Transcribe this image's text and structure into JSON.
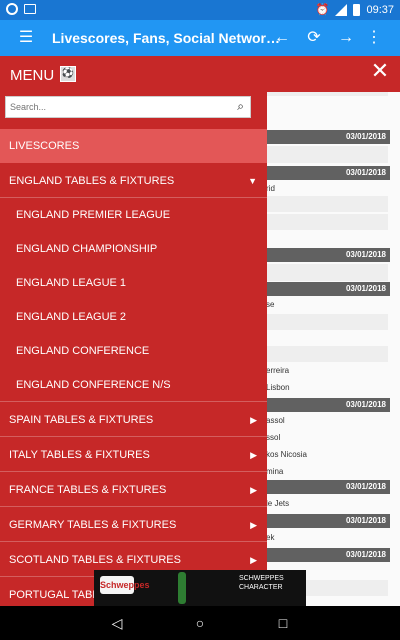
{
  "status_bar": {
    "time": "09:37"
  },
  "toolbar": {
    "title": "Livescores, Fans, Social Networ…",
    "menu_icon": "hamburger-icon",
    "back_icon": "arrow-left-icon",
    "refresh_icon": "refresh-icon",
    "forward_icon": "arrow-right-icon",
    "more_icon": "more-vert-icon"
  },
  "drawer": {
    "title": "MENU",
    "search_placeholder": "Search...",
    "items": [
      {
        "label": "LIVESCORES"
      },
      {
        "label": "ENGLAND TABLES & FIXTURES"
      },
      {
        "label": "ENGLAND PREMIER LEAGUE"
      },
      {
        "label": "ENGLAND CHAMPIONSHIP"
      },
      {
        "label": "ENGLAND LEAGUE 1"
      },
      {
        "label": "ENGLAND LEAGUE 2"
      },
      {
        "label": "ENGLAND CONFERENCE"
      },
      {
        "label": "ENGLAND CONFERENCE N/S"
      },
      {
        "label": "SPAIN TABLES & FIXTURES"
      },
      {
        "label": "ITALY TABLES & FIXTURES"
      },
      {
        "label": "FRANCE TABLES & FIXTURES"
      },
      {
        "label": "GERMARY TABLES & FIXTURES"
      },
      {
        "label": "SCOTLAND TABLES & FIXTURES"
      },
      {
        "label": "PORTUGAL TABLES"
      }
    ]
  },
  "content": {
    "dates": [
      "03/01/2018",
      "03/01/2018",
      "03/01/2018",
      "03/01/2018",
      "03/01/2018",
      "03/01/2018",
      "03/01/2018",
      "03/01/2018"
    ],
    "teams": [
      "rid",
      "se",
      "erreira",
      "Lisbon",
      "assol",
      "ssol",
      "kos Nicosia",
      "mina",
      "le Jets",
      "ek"
    ]
  },
  "ad": {
    "logo_text": "Schweppes",
    "line1": "SCHWEPPES",
    "line2": "CHARACTER"
  }
}
